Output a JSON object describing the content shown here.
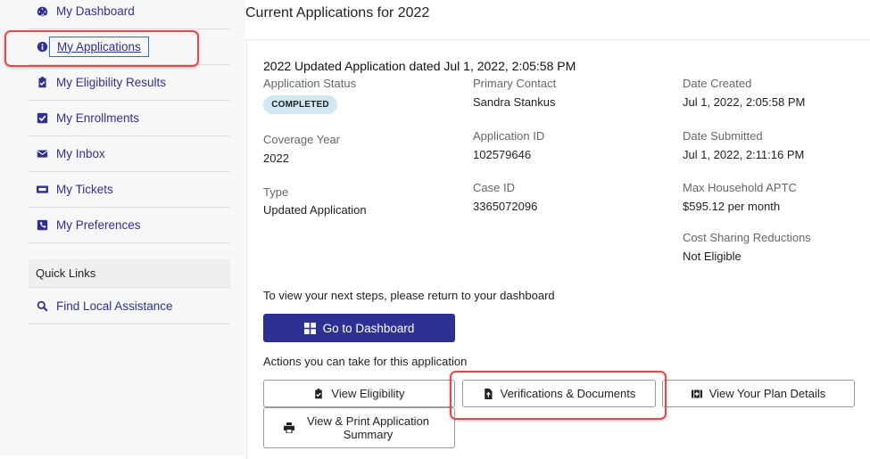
{
  "sidebar": {
    "items": [
      {
        "label": "My Dashboard",
        "icon": "dashboard-gauge-icon"
      },
      {
        "label": "My Applications",
        "icon": "info-circle-icon"
      },
      {
        "label": "My Eligibility Results",
        "icon": "clipboard-check-icon"
      },
      {
        "label": "My Enrollments",
        "icon": "checkbox-icon"
      },
      {
        "label": "My Inbox",
        "icon": "envelope-icon"
      },
      {
        "label": "My Tickets",
        "icon": "ticket-icon"
      },
      {
        "label": "My Preferences",
        "icon": "phone-square-icon"
      }
    ],
    "quick_links_header": "Quick Links",
    "quick_links": [
      {
        "label": "Find Local Assistance",
        "icon": "search-icon"
      }
    ]
  },
  "main": {
    "title": "Current Applications for 2022",
    "application": {
      "title": "2022 Updated Application dated Jul 1, 2022, 2:05:58 PM",
      "status_label": "Application Status",
      "status_value": "COMPLETED",
      "coverage_year_label": "Coverage Year",
      "coverage_year_value": "2022",
      "type_label": "Type",
      "type_value": "Updated Application",
      "primary_contact_label": "Primary Contact",
      "primary_contact_value": "Sandra Stankus",
      "application_id_label": "Application ID",
      "application_id_value": "102579646",
      "case_id_label": "Case ID",
      "case_id_value": "3365072096",
      "date_created_label": "Date Created",
      "date_created_value": "Jul 1, 2022, 2:05:58 PM",
      "date_submitted_label": "Date Submitted",
      "date_submitted_value": "Jul 1, 2022, 2:11:16 PM",
      "aptc_label": "Max Household APTC",
      "aptc_value": "$595.12 per month",
      "csr_label": "Cost Sharing Reductions",
      "csr_value": "Not Eligible"
    },
    "next_steps_text": "To view your next steps, please return to your dashboard",
    "dashboard_button": "Go to Dashboard",
    "actions_text": "Actions you can take for this application",
    "actions": {
      "view_eligibility": "View Eligibility",
      "verifications": "Verifications & Documents",
      "plan_details": "View Your Plan Details",
      "print_summary": "View & Print Application Summary"
    }
  },
  "colors": {
    "brand": "#2d3191",
    "highlight_red": "#e24a4a",
    "badge_bg": "#cfe8f1"
  }
}
